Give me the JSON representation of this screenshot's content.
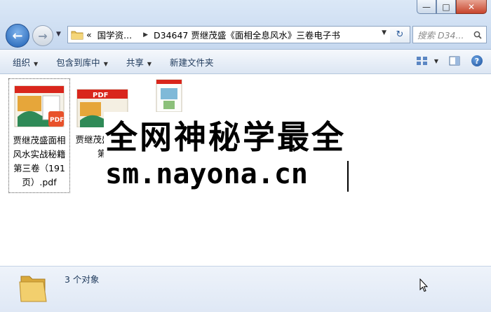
{
  "window": {
    "controls": {
      "minimize": "—",
      "maximize": "□",
      "close": "✕"
    }
  },
  "nav": {
    "back_icon": "back-arrow-icon",
    "forward_icon": "forward-arrow-icon",
    "recent_dropdown_icon": "chevron-down-icon"
  },
  "address": {
    "overflow": "«",
    "crumbs": [
      "国学资...",
      "D34647 贾继茂盛《面相全息风水》三卷电子书"
    ]
  },
  "search": {
    "placeholder": "搜索 D34..."
  },
  "toolbar": {
    "organize": "组织",
    "include_in_library": "包含到库中",
    "share": "共享",
    "new_folder": "新建文件夹"
  },
  "files": [
    {
      "name": "贾继茂盛面相风水实战秘籍第三卷（191页）.pdf",
      "selected": true
    },
    {
      "name": "贾继茂盛全息 第",
      "selected": false
    },
    {
      "name": "",
      "selected": false
    }
  ],
  "overlay": {
    "line1": "全网神秘学最全",
    "line2": "sm.nayona.cn"
  },
  "details": {
    "count_text": "3 个对象"
  },
  "colors": {
    "accent": "#1e395b",
    "title_bg": "#c6d8ef",
    "close_red": "#c7452c",
    "pdf_red": "#d9261c"
  }
}
